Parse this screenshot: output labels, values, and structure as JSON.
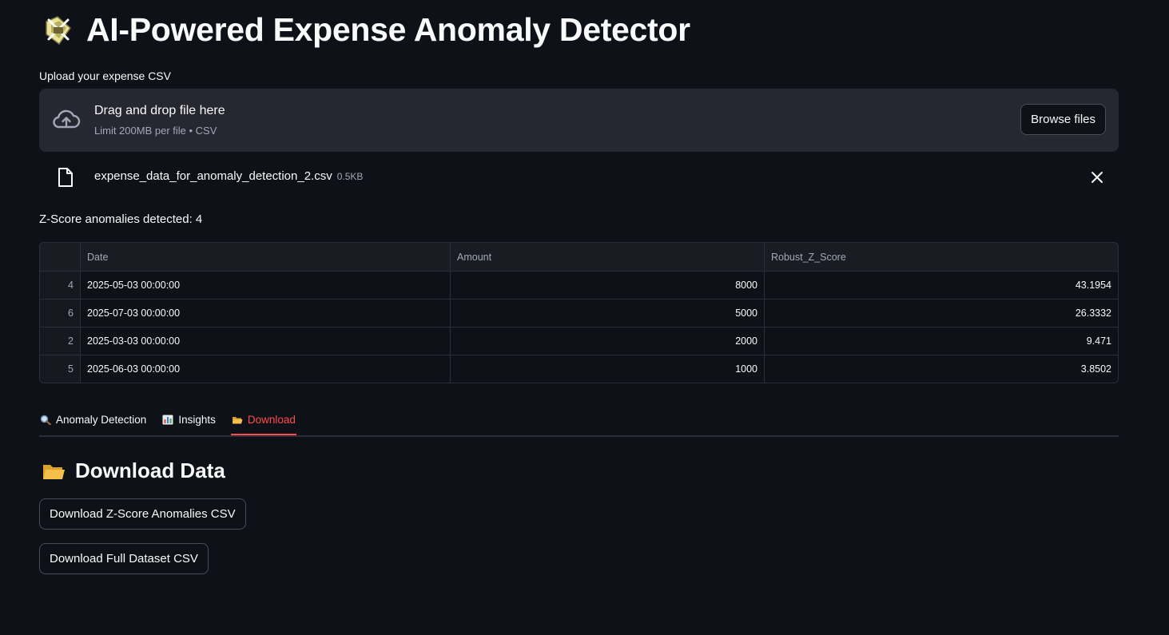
{
  "header": {
    "title": "AI-Powered Expense Anomaly Detector",
    "icon": "logo-icon"
  },
  "uploader": {
    "label": "Upload your expense CSV",
    "drop_title": "Drag and drop file here",
    "drop_subtitle": "Limit 200MB per file • CSV",
    "browse_label": "Browse files",
    "icon": "cloud-upload-icon"
  },
  "file": {
    "name": "expense_data_for_anomaly_detection_2.csv",
    "size": "0.5KB",
    "icon": "file-icon"
  },
  "results": {
    "summary": "Z-Score anomalies detected: 4",
    "table": {
      "columns": [
        "",
        "Date",
        "Amount",
        "Robust_Z_Score"
      ],
      "rows": [
        {
          "index": "4",
          "date": "2025-05-03 00:00:00",
          "amount": "8000",
          "score": "43.1954"
        },
        {
          "index": "6",
          "date": "2025-07-03 00:00:00",
          "amount": "5000",
          "score": "26.3332"
        },
        {
          "index": "2",
          "date": "2025-03-03 00:00:00",
          "amount": "2000",
          "score": "9.471"
        },
        {
          "index": "5",
          "date": "2025-06-03 00:00:00",
          "amount": "1000",
          "score": "3.8502"
        }
      ]
    }
  },
  "tabs": [
    {
      "label": "Anomaly Detection",
      "icon": "magnifier-icon",
      "active": false
    },
    {
      "label": "Insights",
      "icon": "bar-chart-icon",
      "active": false
    },
    {
      "label": "Download",
      "icon": "folder-icon",
      "active": true
    }
  ],
  "download": {
    "section_title": "Download Data",
    "icon": "folder-icon",
    "btn_anomalies": "Download Z-Score Anomalies CSV",
    "btn_full": "Download Full Dataset CSV"
  },
  "colors": {
    "background": "#0e1117",
    "surface": "#262730",
    "accent": "#ff4b4b"
  }
}
